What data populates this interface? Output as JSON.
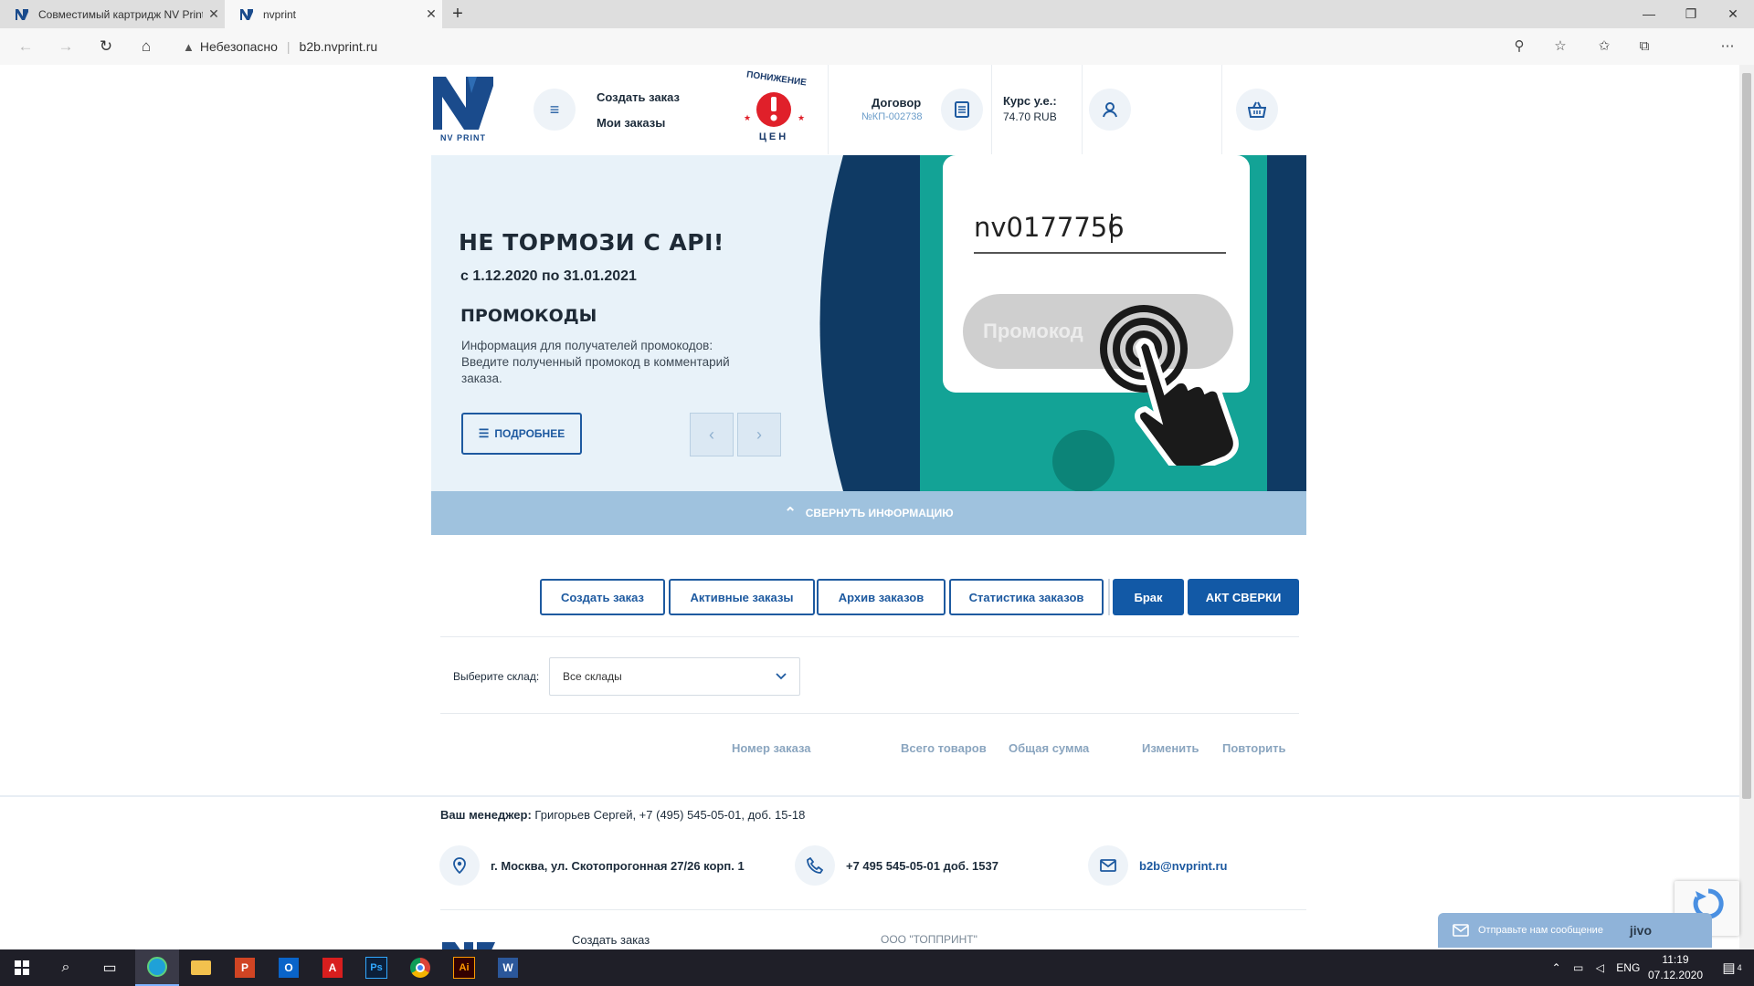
{
  "browser": {
    "tabs": [
      {
        "title": "Совместимый картридж NV Print"
      },
      {
        "title": "nvprint"
      }
    ],
    "security_text": "Небезопасно",
    "url": "b2b.nvprint.ru"
  },
  "header": {
    "logo_text": "NV PRINT",
    "links": {
      "create_order": "Создать заказ",
      "my_orders": "Мои заказы"
    },
    "price_badge": {
      "top": "ПОНИЖЕНИЕ",
      "bottom": "ЦЕН",
      "mark": "!"
    },
    "contract": {
      "title": "Договор",
      "number": "№КП-002738"
    },
    "rate": {
      "title": "Курс у.е.:",
      "value": "74.70 RUB"
    }
  },
  "banner": {
    "title": "НЕ ТОРМОЗИ С API!",
    "dates": "с 1.12.2020 по 31.01.2021",
    "subtitle": "ПРОМОКОДЫ",
    "text": "Информация для получателей промокодов: Введите полученный промокод в комментарий заказа.",
    "more_button": "ПОДРОБНЕЕ",
    "code_value": "nv0177756",
    "promo_button": "Промокод",
    "collapse_label": "СВЕРНУТЬ ИНФОРМАЦИЮ"
  },
  "orders": {
    "tabs": [
      {
        "label": "Создать заказ"
      },
      {
        "label": "Активные заказы"
      },
      {
        "label": "Архив заказов"
      },
      {
        "label": "Статистика заказов"
      }
    ],
    "brak_label": "Брак",
    "act_label": "АКТ СВЕРКИ",
    "warehouse_label": "Выберите склад:",
    "warehouse_value": "Все склады",
    "columns": [
      "Номер заказа",
      "Всего товаров",
      "Общая сумма",
      "Изменить",
      "Повторить"
    ]
  },
  "footer": {
    "manager_label": "Ваш менеджер:",
    "manager_value": "Григорьев Сергей, +7 (495) 545-05-01, доб. 15-18",
    "address": "г. Москва, ул. Скотопрогонная 27/26 корп. 1",
    "phone": "+7 495 545-05-01 доб. 1537",
    "email": "b2b@nvprint.ru",
    "link_create": "Создать заказ",
    "company": "ООО \"ТОППРИНТ\"",
    "jivo_text": "Отправьте нам сообщение",
    "jivo_brand": "jivo"
  },
  "taskbar": {
    "language": "ENG",
    "time": "11:19",
    "date": "07.12.2020",
    "notifications": "4"
  },
  "colors": {
    "brand_blue": "#1259a6",
    "banner_bg": "#e8f2f9",
    "banner_teal": "#13a396",
    "banner_navy": "#0f3a64",
    "collapse_bar": "#9fc2de",
    "badge_red": "#e0202a"
  }
}
